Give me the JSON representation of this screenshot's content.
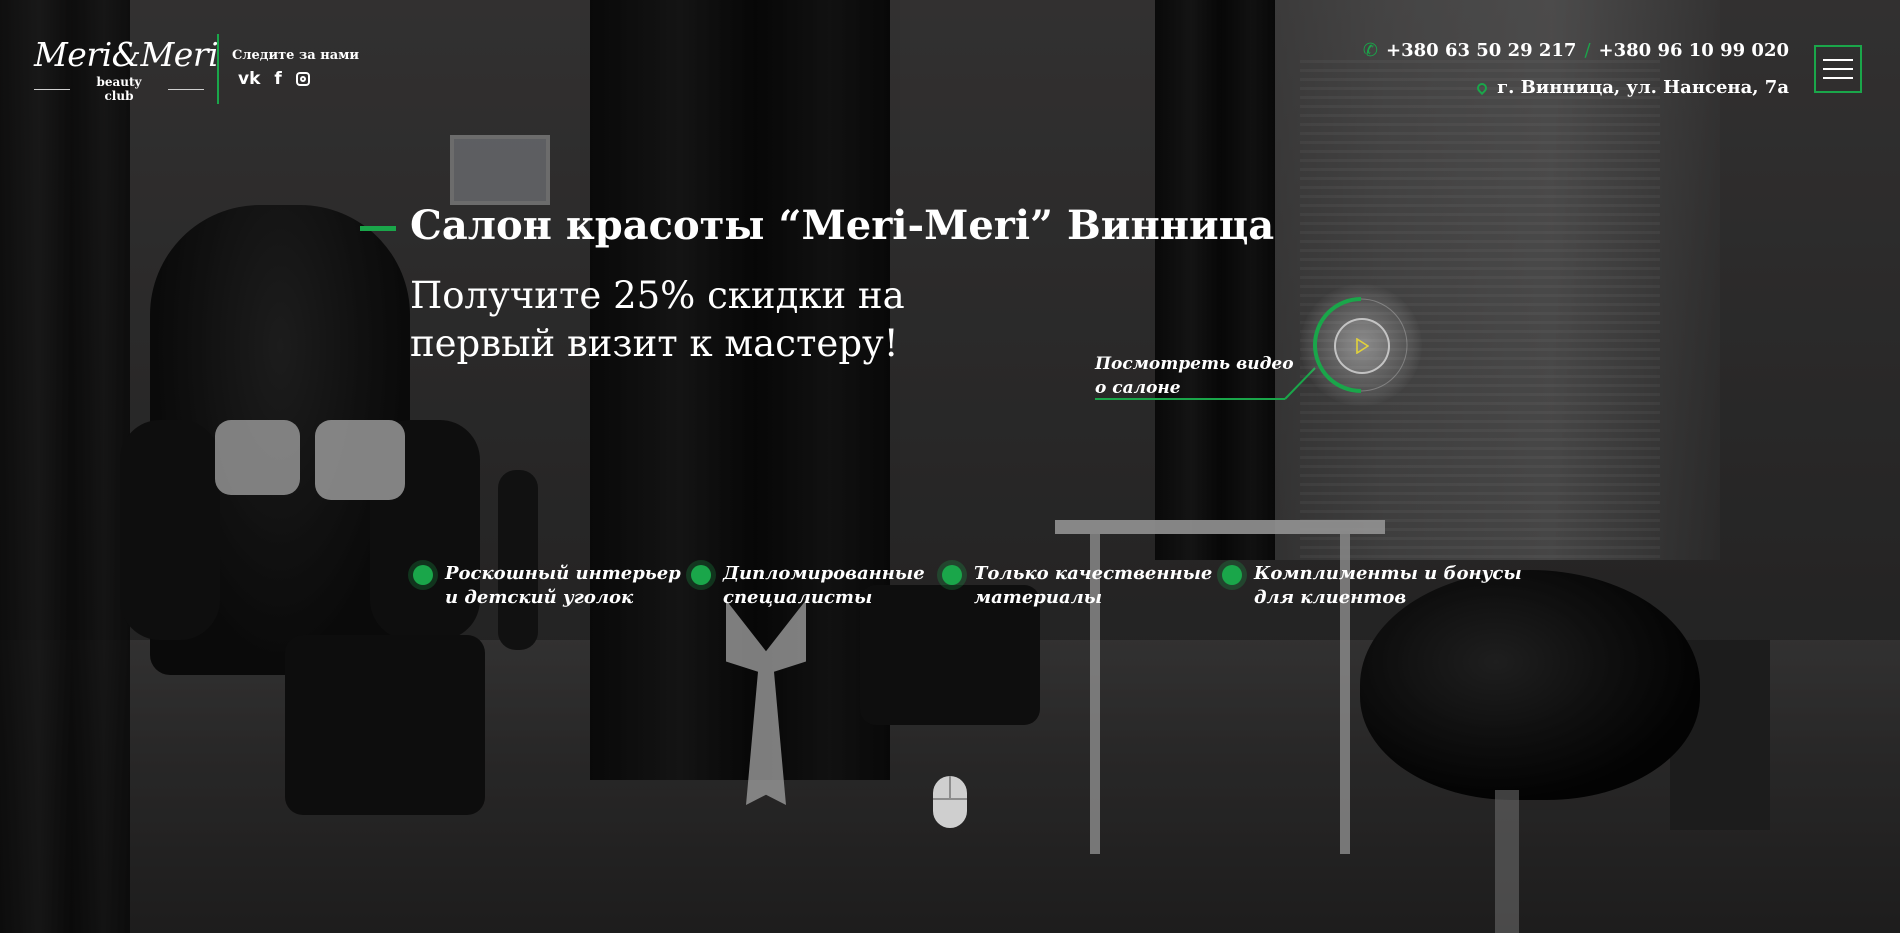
{
  "brand": {
    "name": "Meri&Meri",
    "tagline": "beauty club"
  },
  "header": {
    "follow_label": "Следите за нами",
    "socials": [
      "vk-icon",
      "facebook-icon",
      "instagram-icon"
    ],
    "phone1": "+380 63 50 29 217",
    "separator": "/",
    "phone2": "+380 96 10 99 020",
    "address": "г. Винница, ул. Нансена, 7а",
    "menu_icon": "hamburger-icon"
  },
  "hero": {
    "title": "Салон красоты “Meri-Meri” Винница",
    "subtitle": "Получите 25% скидки на первый визит к мастеру!",
    "video_line1": "Посмотреть видео",
    "video_line2": "о салоне"
  },
  "features": [
    {
      "line1": "Роскошный интерьер",
      "line2": "и детский уголок"
    },
    {
      "line1": "Дипломированные",
      "line2": "специалисты"
    },
    {
      "line1": "Только качественные",
      "line2": "материалы"
    },
    {
      "line1": "Комплименты и бонусы",
      "line2": "для клиентов"
    }
  ],
  "colors": {
    "accent": "#1aa64a",
    "play_icon": "#e3d23a"
  }
}
